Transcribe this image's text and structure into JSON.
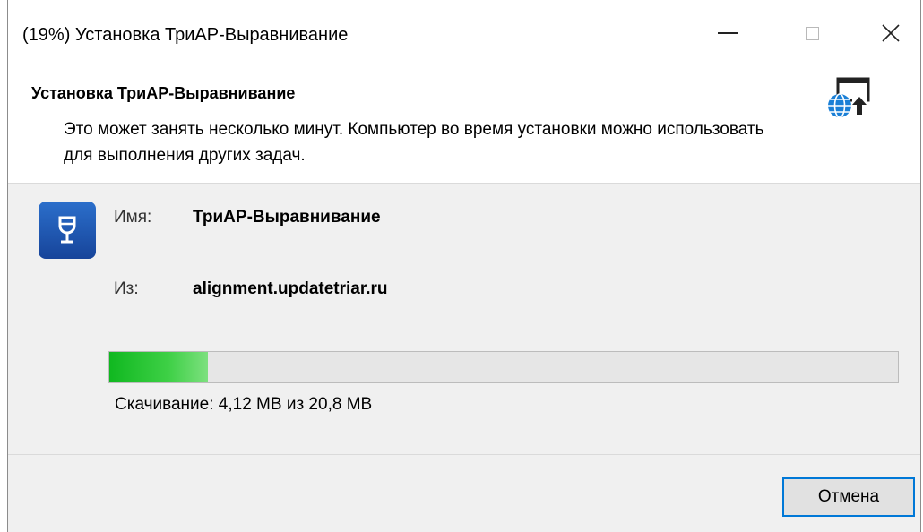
{
  "window": {
    "title": "(19%) Установка ТриАР-Выравнивание"
  },
  "header": {
    "title": "Установка ТриАР-Выравнивание",
    "description": "Это может занять несколько минут. Компьютер во время установки можно использовать для выполнения других задач.",
    "icon": "globe-install-icon"
  },
  "app": {
    "icon": "wine-glass-icon",
    "name_label": "Имя:",
    "name_value": "ТриАР-Выравнивание",
    "from_label": "Из:",
    "from_value": "alignment.updatetriar.ru"
  },
  "progress": {
    "fraction": 0.125,
    "status": "Скачивание: 4,12 MB из 20,8 MB",
    "color": "#10b820"
  },
  "buttons": {
    "cancel_label": "Отмена"
  },
  "colors": {
    "accent": "#0078d7",
    "app_icon": "#1f5bb5"
  }
}
